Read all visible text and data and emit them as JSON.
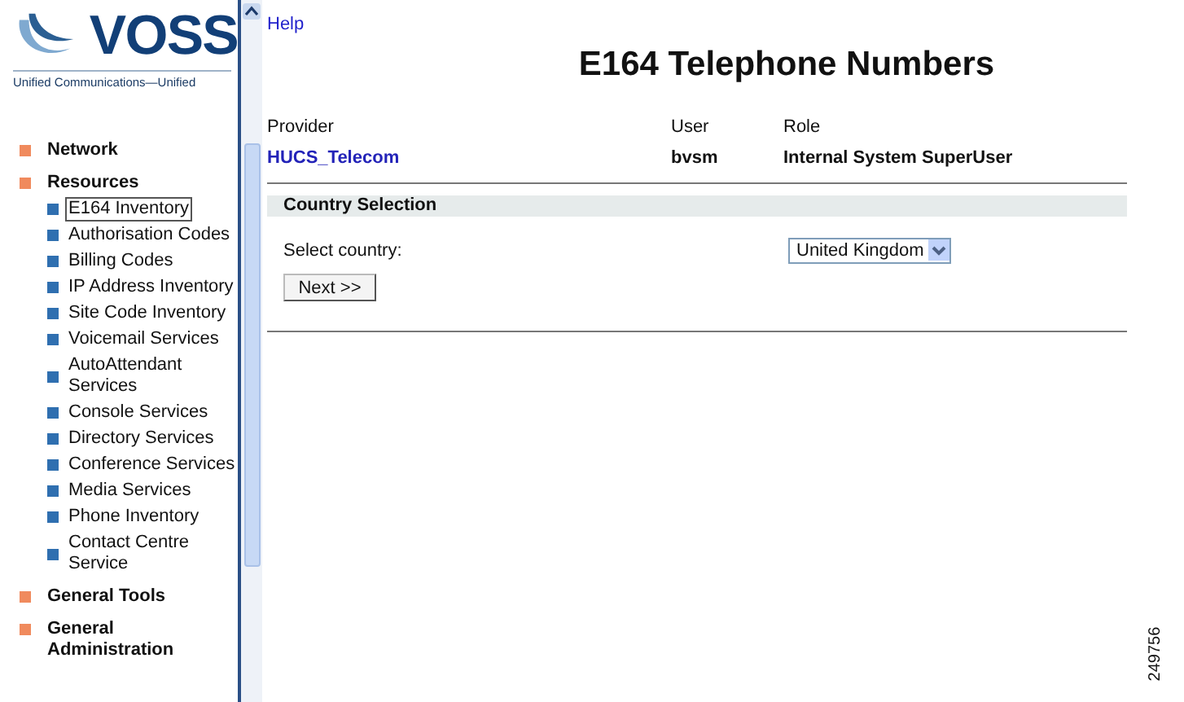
{
  "logo": {
    "name": "VOSS",
    "tagline": "Unified Communications—Unified"
  },
  "sidebar": {
    "items": [
      {
        "label": "Network",
        "selected": false
      },
      {
        "label": "Resources",
        "selected": false,
        "children": [
          {
            "label": "E164 Inventory",
            "selected": true
          },
          {
            "label": "Authorisation Codes",
            "selected": false
          },
          {
            "label": "Billing Codes",
            "selected": false
          },
          {
            "label": "IP Address Inventory",
            "selected": false
          },
          {
            "label": "Site Code Inventory",
            "selected": false
          },
          {
            "label": "Voicemail Services",
            "selected": false
          },
          {
            "label": "AutoAttendant Services",
            "selected": false
          },
          {
            "label": "Console Services",
            "selected": false
          },
          {
            "label": "Directory Services",
            "selected": false
          },
          {
            "label": "Conference Services",
            "selected": false
          },
          {
            "label": "Media Services",
            "selected": false
          },
          {
            "label": "Phone Inventory",
            "selected": false
          },
          {
            "label": "Contact Centre Service",
            "selected": false
          }
        ]
      },
      {
        "label": "General Tools",
        "selected": false
      },
      {
        "label": "General Administration",
        "selected": false
      }
    ]
  },
  "help_link": "Help",
  "title": "E164 Telephone Numbers",
  "info": [
    {
      "label": "Provider",
      "value": "HUCS_Telecom",
      "kind": "link"
    },
    {
      "label": "User",
      "value": "bvsm",
      "kind": "text"
    },
    {
      "label": "Role",
      "value": "Internal System SuperUser",
      "kind": "text"
    }
  ],
  "section": {
    "title": "Country Selection",
    "field_label": "Select country:",
    "value": "United Kingdom",
    "button": "Next >>"
  },
  "figure_id": "249756"
}
